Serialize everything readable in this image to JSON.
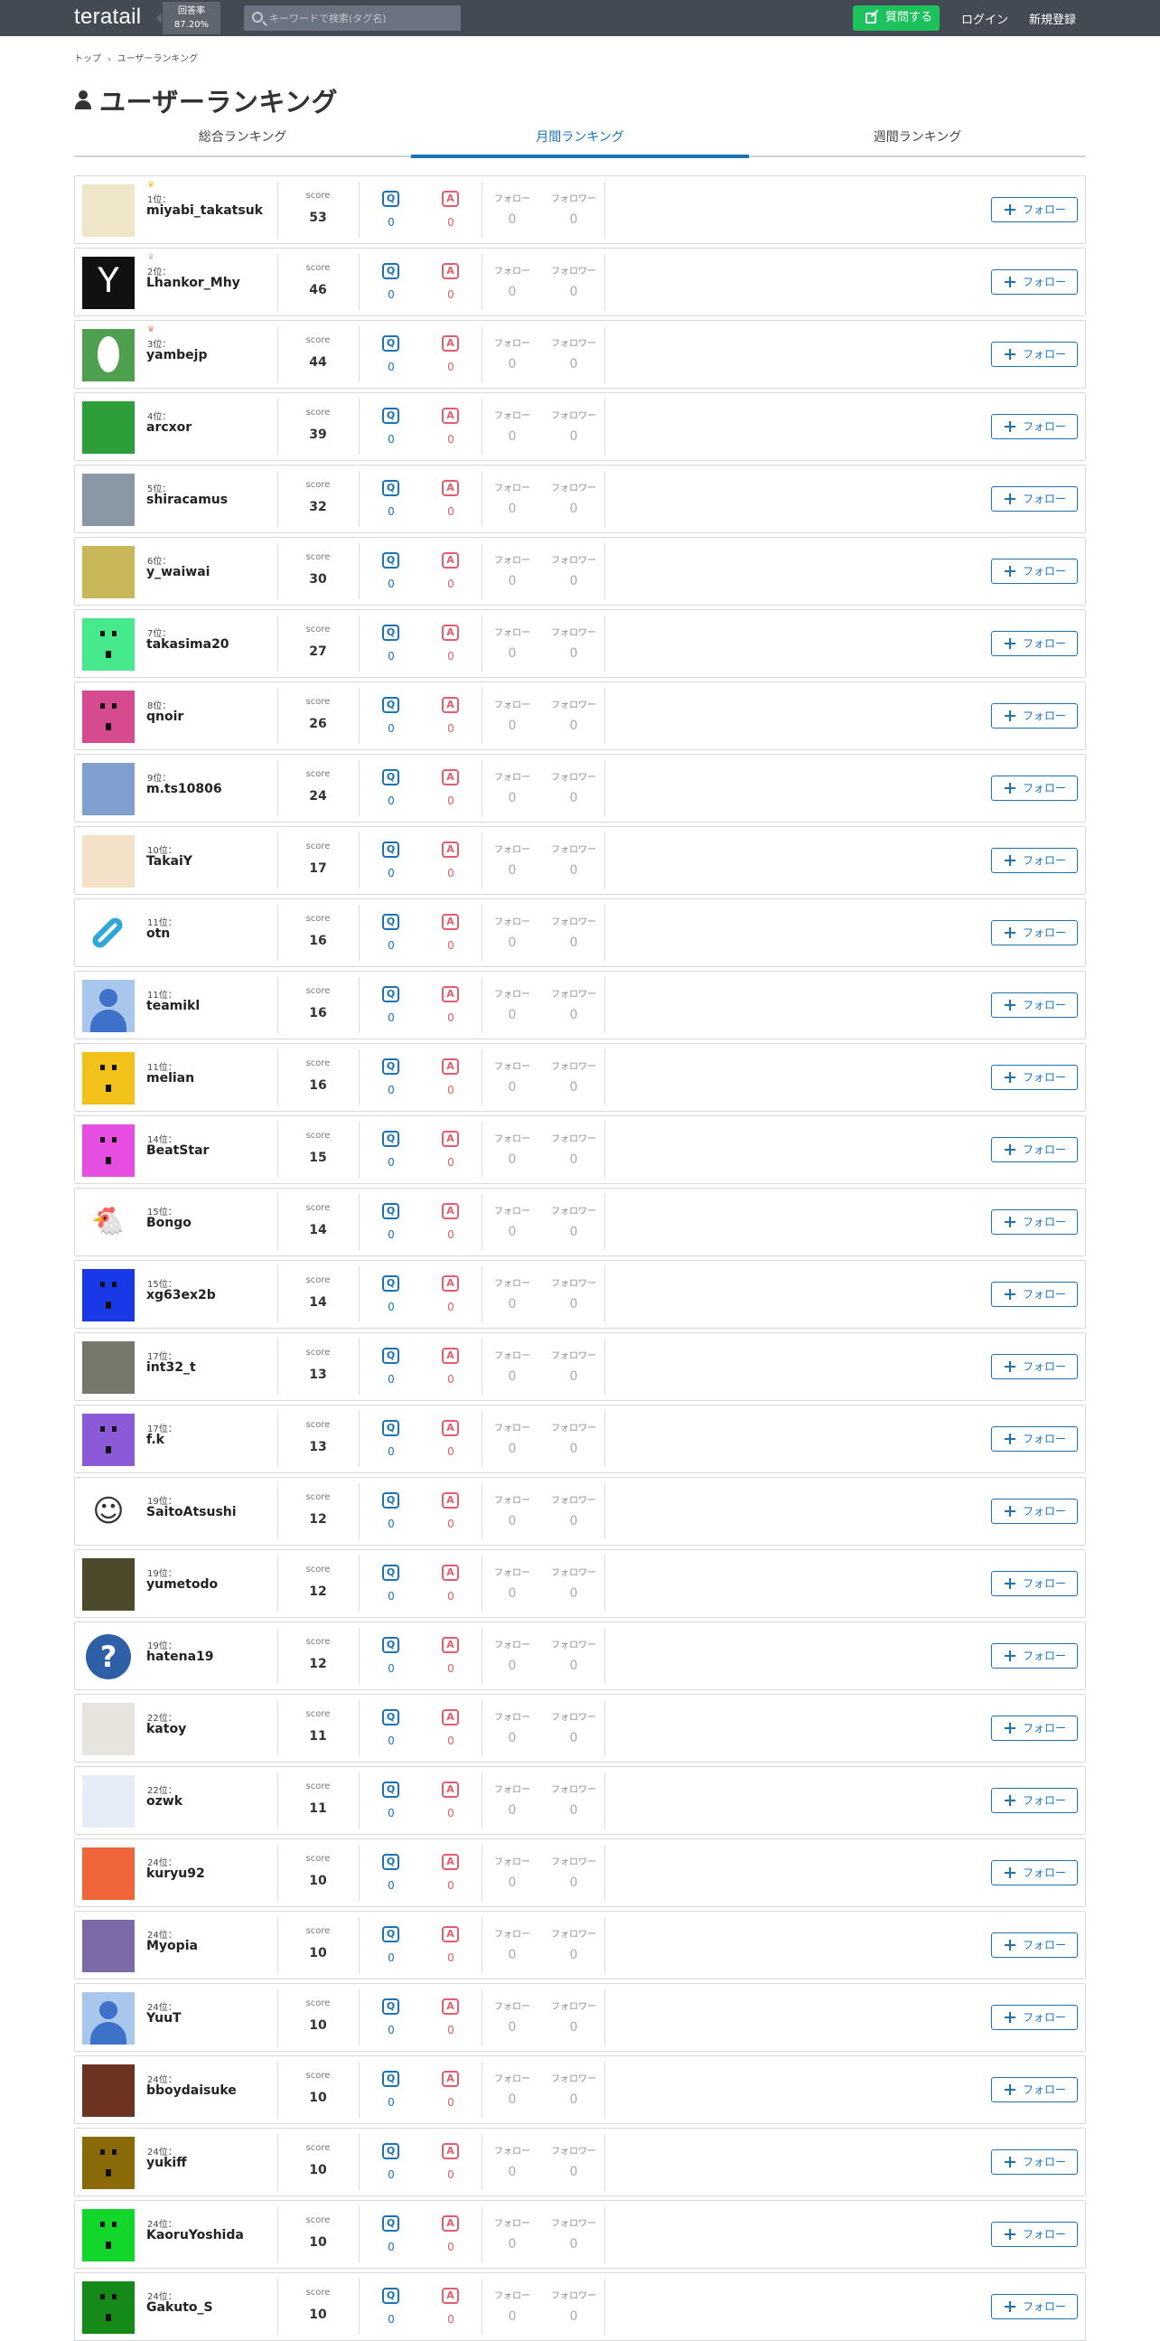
{
  "header": {
    "logo": "teratail",
    "answer_rate_label": "回答率",
    "answer_rate_value": "87.20%",
    "search_placeholder": "キーワードで検索(タグ名)",
    "ask_button": "質問する",
    "login": "ログイン",
    "signup": "新規登録"
  },
  "breadcrumb": [
    "トップ",
    "ユーザーランキング"
  ],
  "page_title": "ユーザーランキング",
  "tabs": [
    {
      "label": "総合ランキング",
      "active": false
    },
    {
      "label": "月間ランキング",
      "active": true
    },
    {
      "label": "週間ランキング",
      "active": false
    }
  ],
  "labels": {
    "score": "score",
    "follow": "フォロー",
    "follower": "フォロワー",
    "follow_button": "フォロー",
    "q_icon": "Q",
    "a_icon": "A"
  },
  "colors": {
    "header_bg": "#434a54",
    "accent_blue": "#1a73b8",
    "answer_red": "#e35d6a",
    "ask_green": "#1ec25c",
    "gold_crown": "#f0c419",
    "silver_crown": "#c0c0c0",
    "bronze_crown": "#d08a5a"
  },
  "users": [
    {
      "rank": "1位：",
      "name": "miyabi_takatsuk",
      "score": "53",
      "q": "0",
      "a": "0",
      "follow": "0",
      "follower": "0",
      "crown": "gold",
      "avatar": "caricature-face-avatar"
    },
    {
      "rank": "2位：",
      "name": "Lhankor_Mhy",
      "score": "46",
      "q": "0",
      "a": "0",
      "follow": "0",
      "follower": "0",
      "crown": "silver",
      "avatar": "y-letter-avatar"
    },
    {
      "rank": "3位：",
      "name": "yambejp",
      "score": "44",
      "q": "0",
      "a": "0",
      "follow": "0",
      "follower": "0",
      "crown": "bronze",
      "avatar": "egg-avatar"
    },
    {
      "rank": "4位：",
      "name": "arcxor",
      "score": "39",
      "q": "0",
      "a": "0",
      "follow": "0",
      "follower": "0",
      "crown": "",
      "avatar": "green-pattern-avatar"
    },
    {
      "rank": "5位：",
      "name": "shiracamus",
      "score": "32",
      "q": "0",
      "a": "0",
      "follow": "0",
      "follower": "0",
      "crown": "",
      "avatar": "snow-mountain-photo-avatar"
    },
    {
      "rank": "6位：",
      "name": "y_waiwai",
      "score": "30",
      "q": "0",
      "a": "0",
      "follow": "0",
      "follower": "0",
      "crown": "",
      "avatar": "rubber-duck-photo-avatar"
    },
    {
      "rank": "7位：",
      "name": "takasima20",
      "score": "27",
      "q": "0",
      "a": "0",
      "follow": "0",
      "follower": "0",
      "crown": "",
      "avatar": "identicon-avatar"
    },
    {
      "rank": "8位：",
      "name": "qnoir",
      "score": "26",
      "q": "0",
      "a": "0",
      "follow": "0",
      "follower": "0",
      "crown": "",
      "avatar": "identicon-avatar"
    },
    {
      "rank": "9位：",
      "name": "m.ts10806",
      "score": "24",
      "q": "0",
      "a": "0",
      "follow": "0",
      "follower": "0",
      "crown": "",
      "avatar": "blurred-photo-avatar"
    },
    {
      "rank": "10位：",
      "name": "TakaiY",
      "score": "17",
      "q": "0",
      "a": "0",
      "follow": "0",
      "follower": "0",
      "crown": "",
      "avatar": "cartoon-face-avatar"
    },
    {
      "rank": "11位：",
      "name": "otn",
      "score": "16",
      "q": "0",
      "a": "0",
      "follow": "0",
      "follower": "0",
      "crown": "",
      "avatar": "link-icon-avatar"
    },
    {
      "rank": "11位：",
      "name": "teamikl",
      "score": "16",
      "q": "0",
      "a": "0",
      "follow": "0",
      "follower": "0",
      "crown": "",
      "avatar": "default-person-avatar"
    },
    {
      "rank": "11位：",
      "name": "melian",
      "score": "16",
      "q": "0",
      "a": "0",
      "follow": "0",
      "follower": "0",
      "crown": "",
      "avatar": "identicon-avatar"
    },
    {
      "rank": "14位：",
      "name": "BeatStar",
      "score": "15",
      "q": "0",
      "a": "0",
      "follow": "0",
      "follower": "0",
      "crown": "",
      "avatar": "identicon-avatar"
    },
    {
      "rank": "15位：",
      "name": "Bongo",
      "score": "14",
      "q": "0",
      "a": "0",
      "follow": "0",
      "follower": "0",
      "crown": "",
      "avatar": "chicken-avatar"
    },
    {
      "rank": "15位：",
      "name": "xg63ex2b",
      "score": "14",
      "q": "0",
      "a": "0",
      "follow": "0",
      "follower": "0",
      "crown": "",
      "avatar": "identicon-avatar"
    },
    {
      "rank": "17位：",
      "name": "int32_t",
      "score": "13",
      "q": "0",
      "a": "0",
      "follow": "0",
      "follower": "0",
      "crown": "",
      "avatar": "road-photo-avatar"
    },
    {
      "rank": "17位：",
      "name": "f.k",
      "score": "13",
      "q": "0",
      "a": "0",
      "follow": "0",
      "follower": "0",
      "crown": "",
      "avatar": "identicon-avatar"
    },
    {
      "rank": "19位：",
      "name": "SaitoAtsushi",
      "score": "12",
      "q": "0",
      "a": "0",
      "follow": "0",
      "follower": "0",
      "crown": "",
      "avatar": "face-drawing-avatar"
    },
    {
      "rank": "19位：",
      "name": "yumetodo",
      "score": "12",
      "q": "0",
      "a": "0",
      "follow": "0",
      "follower": "0",
      "crown": "",
      "avatar": "night-photo-avatar"
    },
    {
      "rank": "19位：",
      "name": "hatena19",
      "score": "12",
      "q": "0",
      "a": "0",
      "follow": "0",
      "follower": "0",
      "crown": "",
      "avatar": "question-mark-avatar"
    },
    {
      "rank": "22位：",
      "name": "katoy",
      "score": "11",
      "q": "0",
      "a": "0",
      "follow": "0",
      "follower": "0",
      "crown": "",
      "avatar": "seahorse-avatar"
    },
    {
      "rank": "22位：",
      "name": "ozwk",
      "score": "11",
      "q": "0",
      "a": "0",
      "follow": "0",
      "follower": "0",
      "crown": "",
      "avatar": "blue-pattern-avatar"
    },
    {
      "rank": "24位：",
      "name": "kuryu92",
      "score": "10",
      "q": "0",
      "a": "0",
      "follow": "0",
      "follower": "0",
      "crown": "",
      "avatar": "orange-pattern-avatar"
    },
    {
      "rank": "24位：",
      "name": "Myopia",
      "score": "10",
      "q": "0",
      "a": "0",
      "follow": "0",
      "follower": "0",
      "crown": "",
      "avatar": "purple-pattern-avatar"
    },
    {
      "rank": "24位：",
      "name": "YuuT",
      "score": "10",
      "q": "0",
      "a": "0",
      "follow": "0",
      "follower": "0",
      "crown": "",
      "avatar": "default-person-avatar"
    },
    {
      "rank": "24位：",
      "name": "bboydaisuke",
      "score": "10",
      "q": "0",
      "a": "0",
      "follow": "0",
      "follower": "0",
      "crown": "",
      "avatar": "guitar-photo-avatar"
    },
    {
      "rank": "24位：",
      "name": "yukiff",
      "score": "10",
      "q": "0",
      "a": "0",
      "follow": "0",
      "follower": "0",
      "crown": "",
      "avatar": "identicon-avatar"
    },
    {
      "rank": "24位：",
      "name": "KaoruYoshida",
      "score": "10",
      "q": "0",
      "a": "0",
      "follow": "0",
      "follower": "0",
      "crown": "",
      "avatar": "identicon-avatar"
    },
    {
      "rank": "24位：",
      "name": "Gakuto_S",
      "score": "10",
      "q": "0",
      "a": "0",
      "follow": "0",
      "follower": "0",
      "crown": "",
      "avatar": "identicon-avatar"
    }
  ]
}
